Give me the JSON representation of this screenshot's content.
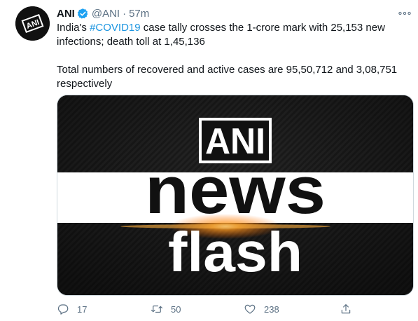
{
  "tweet": {
    "display_name": "ANI",
    "handle": "@ANI",
    "separator": "·",
    "time": "57m",
    "text_line1_before": "India's ",
    "hashtag": "#COVID19",
    "text_line1_after": " case tally crosses the 1-crore mark with 25,153 new infections; death toll at 1,45,136",
    "text_paragraph2": "Total numbers of recovered and active cases are 95,50,712 and 3,08,751 respectively",
    "avatar_text": "ANI",
    "media": {
      "logo_text": "ANI",
      "headline_line1": "news",
      "headline_line2": "flash"
    },
    "actions": {
      "replies": "17",
      "retweets": "50",
      "likes": "238"
    },
    "colors": {
      "link": "#1b95e0",
      "muted": "#5b7083",
      "verified": "#1da1f2"
    }
  }
}
